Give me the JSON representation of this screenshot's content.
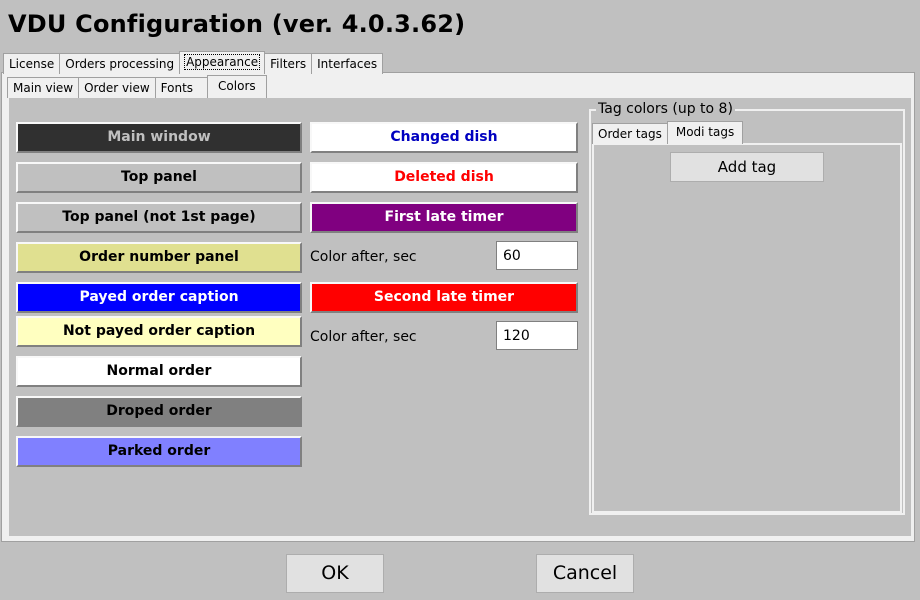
{
  "window": {
    "title": "VDU Configuration (ver. 4.0.3.62)"
  },
  "outer_tabs": [
    "License",
    "Orders processing",
    "Appearance",
    "Filters",
    "Interfaces"
  ],
  "inner_tabs": [
    "Main view",
    "Order view",
    "Fonts",
    "Colors"
  ],
  "left_buttons": [
    {
      "label": "Main window",
      "bg": "#303030",
      "fg": "#c0c0c0"
    },
    {
      "label": "Top panel",
      "bg": "#c0c0c0",
      "fg": "#000000"
    },
    {
      "label": "Top panel (not 1st page)",
      "bg": "#c0c0c0",
      "fg": "#000000"
    },
    {
      "label": "Order number panel",
      "bg": "#e0e090",
      "fg": "#000000"
    },
    {
      "label": "Payed order caption",
      "bg": "#0000ff",
      "fg": "#ffffff"
    },
    {
      "label": "Not payed order caption",
      "bg": "#ffffc0",
      "fg": "#000000"
    },
    {
      "label": "Normal order",
      "bg": "#ffffff",
      "fg": "#000000"
    },
    {
      "label": "Droped order",
      "bg": "#808080",
      "fg": "#000000"
    },
    {
      "label": "Parked order",
      "bg": "#8080ff",
      "fg": "#000000"
    }
  ],
  "middle_buttons": [
    {
      "label": "Changed dish",
      "bg": "#ffffff",
      "fg": "#0000c0"
    },
    {
      "label": "Deleted dish",
      "bg": "#ffffff",
      "fg": "#ff0000"
    },
    {
      "label": "First late timer",
      "bg": "#800080",
      "fg": "#ffffff"
    },
    {
      "label": "Second late timer",
      "bg": "#ff0000",
      "fg": "#ffffff"
    }
  ],
  "timers": [
    {
      "label": "Color after, sec",
      "value": "60"
    },
    {
      "label": "Color after, sec",
      "value": "120"
    }
  ],
  "tag_group": {
    "title": "Tag colors (up to 8)",
    "tabs": [
      "Order tags",
      "Modi tags"
    ],
    "add_tag": "Add tag"
  },
  "dialog": {
    "ok": "OK",
    "cancel": "Cancel"
  }
}
